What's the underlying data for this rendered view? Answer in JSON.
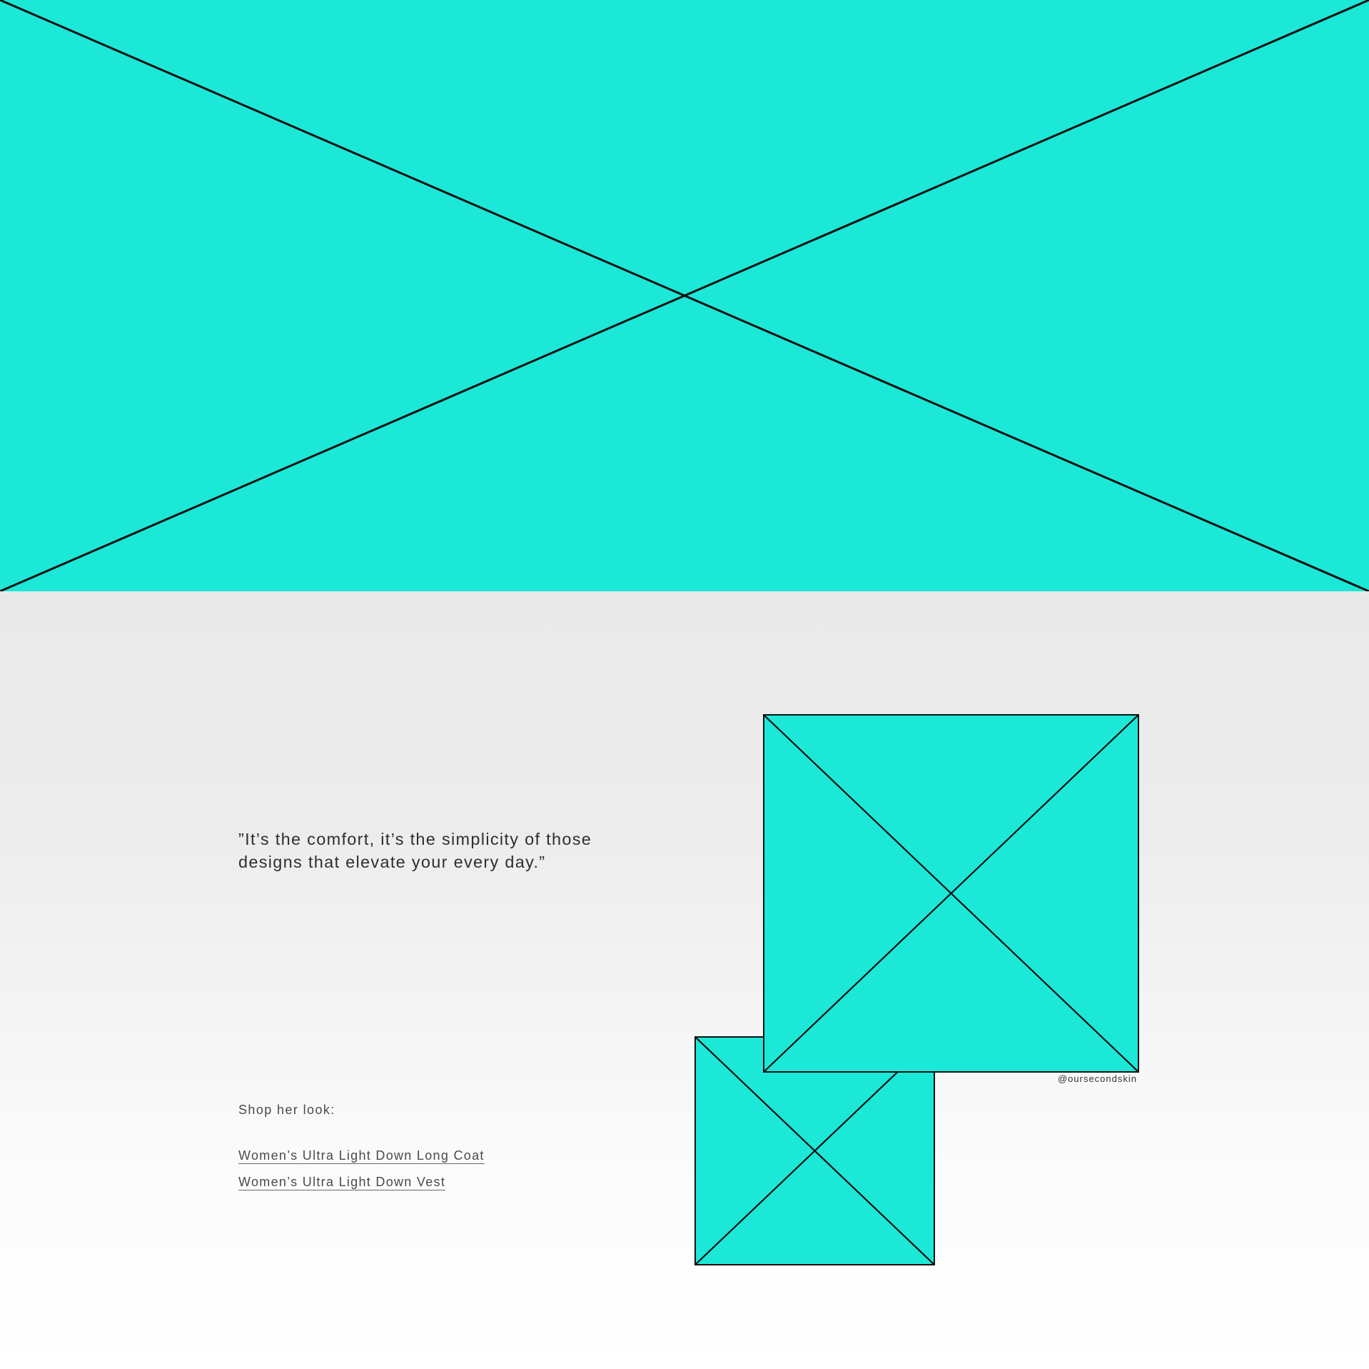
{
  "colors": {
    "placeholder_fill": "#1ce8d8",
    "placeholder_stroke": "#111111",
    "section_background_top": "#e9e9e9",
    "section_background_bottom": "#ffffff",
    "text_primary": "#2f2f2f",
    "text_secondary": "#4a4a4a"
  },
  "hero": {
    "image_placeholder": "image-placeholder-x"
  },
  "testimonial": {
    "quote_line1": "”It’s the comfort, it’s the simplicity of those",
    "quote_line2": "designs that elevate your every day.”"
  },
  "shop": {
    "label": "Shop her look:",
    "links": [
      {
        "label": "Women’s Ultra Light Down Long Coat"
      },
      {
        "label": "Women’s Ultra Light Down Vest"
      }
    ]
  },
  "gallery": {
    "credit": "@oursecondskin"
  }
}
